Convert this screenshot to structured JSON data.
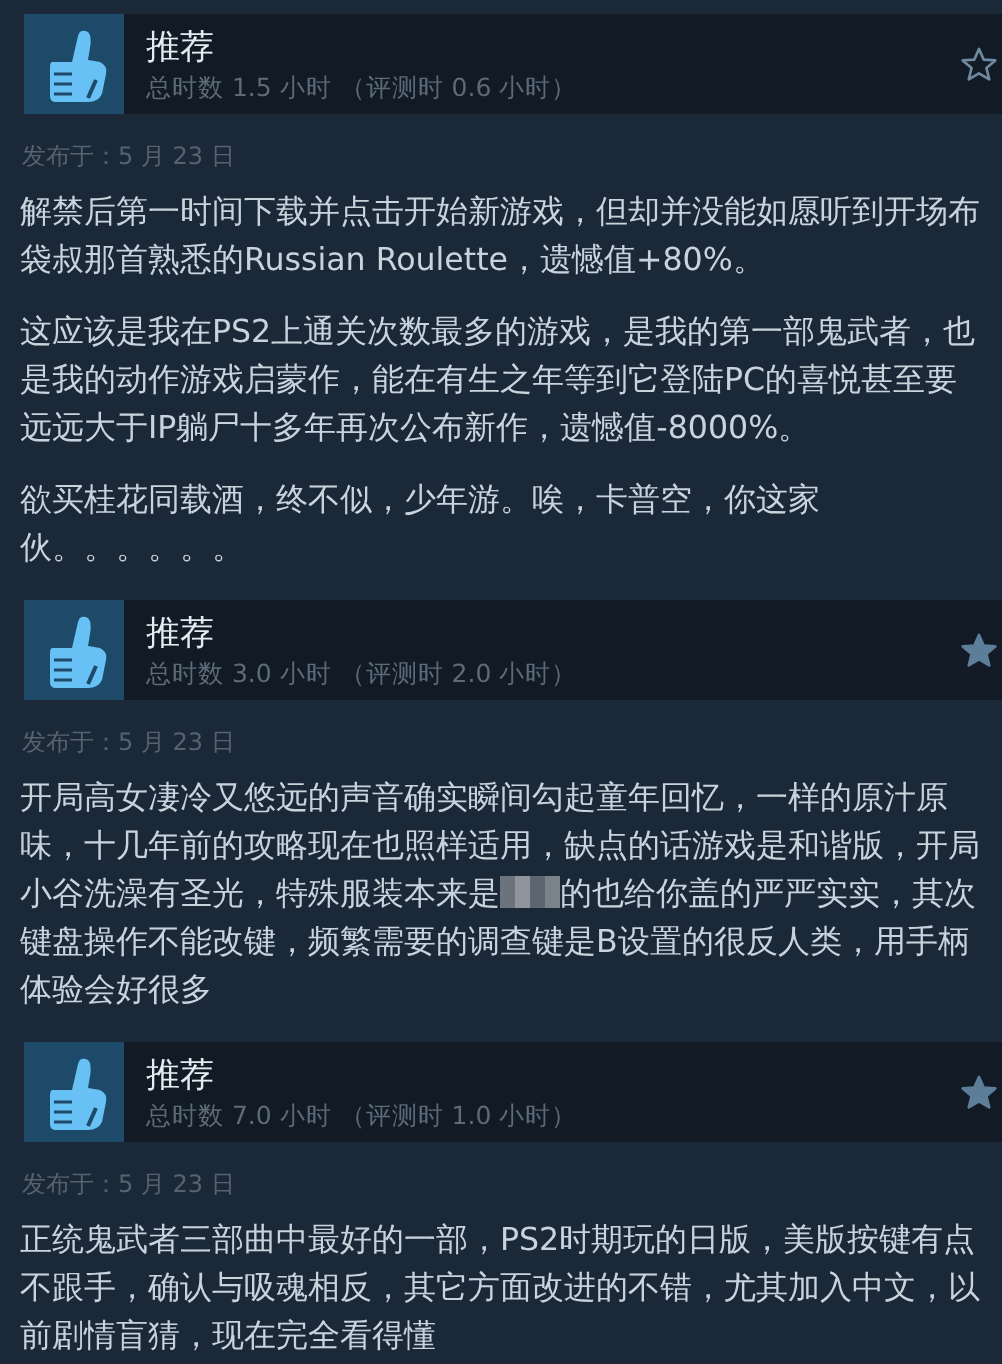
{
  "reviews": [
    {
      "verdict": "推荐",
      "hours": "总时数 1.5 小时 （评测时 0.6 小时）",
      "starred": false,
      "date": "发布于：5 月 23 日",
      "paragraphs": [
        [
          {
            "kind": "text",
            "text": "解禁后第一时间下载并点击开始新游戏，但却并没能如愿听到开场布袋叔那首熟悉的Russian Roulette，遗憾值+80%。"
          }
        ],
        [
          {
            "kind": "text",
            "text": "这应该是我在PS2上通关次数最多的游戏，是我的第一部鬼武者，也是我的动作游戏启蒙作，能在有生之年等到它登陆PC的喜悦甚至要远远大于IP躺尸十多年再次公布新作，遗憾值-8000%。"
          }
        ],
        [
          {
            "kind": "text",
            "text": "欲买桂花同载酒，终不似，少年游。唉，卡普空，你这家伙。。。。。。"
          }
        ]
      ]
    },
    {
      "verdict": "推荐",
      "hours": "总时数 3.0 小时 （评测时 2.0 小时）",
      "starred": true,
      "date": "发布于：5 月 23 日",
      "paragraphs": [
        [
          {
            "kind": "text",
            "text": "开局高女凄冷又悠远的声音确实瞬间勾起童年回忆，一样的原汁原味，十几年前的攻略现在也照样适用，缺点的话游戏是和谐版，开局小谷洗澡有圣光，特殊服装本来是"
          },
          {
            "kind": "redacted"
          },
          {
            "kind": "text",
            "text": "的也给你盖的严严实实，其次键盘操作不能改键，频繁需要的调查键是B设置的很反人类，用手柄体验会好很多"
          }
        ]
      ]
    },
    {
      "verdict": "推荐",
      "hours": "总时数 7.0 小时 （评测时 1.0 小时）",
      "starred": true,
      "date": "发布于：5 月 23 日",
      "paragraphs": [
        [
          {
            "kind": "text",
            "text": "正统鬼武者三部曲中最好的一部，PS2时期玩的日版，美版按键有点不跟手，确认与吸魂相反，其它方面改进的不错，尤其加入中文，以前剧情盲猜，现在完全看得懂"
          }
        ]
      ]
    }
  ]
}
